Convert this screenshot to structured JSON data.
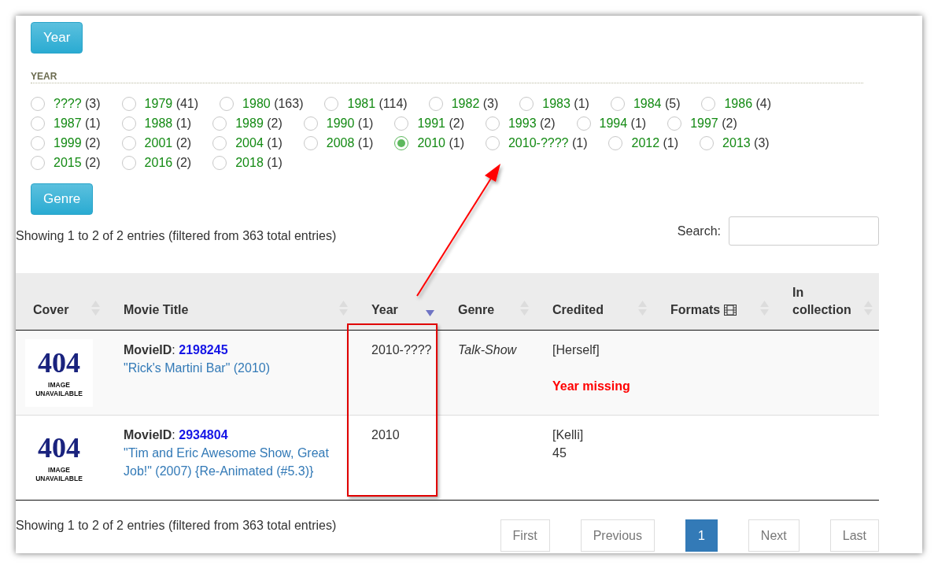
{
  "year_button": "Year",
  "filter_heading": "YEAR",
  "year_options": [
    {
      "label": "????",
      "count": "(3)",
      "selected": false
    },
    {
      "label": "1979",
      "count": "(41)",
      "selected": false
    },
    {
      "label": "1980",
      "count": "(163)",
      "selected": false
    },
    {
      "label": "1981",
      "count": "(114)",
      "selected": false
    },
    {
      "label": "1982",
      "count": "(3)",
      "selected": false
    },
    {
      "label": "1983",
      "count": "(1)",
      "selected": false
    },
    {
      "label": "1984",
      "count": "(5)",
      "selected": false
    },
    {
      "label": "1986",
      "count": "(4)",
      "selected": false
    },
    {
      "label": "1987",
      "count": "(1)",
      "selected": false
    },
    {
      "label": "1988",
      "count": "(1)",
      "selected": false
    },
    {
      "label": "1989",
      "count": "(2)",
      "selected": false
    },
    {
      "label": "1990",
      "count": "(1)",
      "selected": false
    },
    {
      "label": "1991",
      "count": "(2)",
      "selected": false
    },
    {
      "label": "1993",
      "count": "(2)",
      "selected": false
    },
    {
      "label": "1994",
      "count": "(1)",
      "selected": false
    },
    {
      "label": "1997",
      "count": "(2)",
      "selected": false
    },
    {
      "label": "1999",
      "count": "(2)",
      "selected": false
    },
    {
      "label": "2001",
      "count": "(2)",
      "selected": false
    },
    {
      "label": "2004",
      "count": "(1)",
      "selected": false
    },
    {
      "label": "2008",
      "count": "(1)",
      "selected": false
    },
    {
      "label": "2010",
      "count": "(1)",
      "selected": true
    },
    {
      "label": "2010-????",
      "count": "(1)",
      "selected": false
    },
    {
      "label": "2012",
      "count": "(1)",
      "selected": false
    },
    {
      "label": "2013",
      "count": "(3)",
      "selected": false
    },
    {
      "label": "2015",
      "count": "(2)",
      "selected": false
    },
    {
      "label": "2016",
      "count": "(2)",
      "selected": false
    },
    {
      "label": "2018",
      "count": "(1)",
      "selected": false
    }
  ],
  "genre_button": "Genre",
  "info_top": "Showing 1 to 2 of 2 entries (filtered from 363 total entries)",
  "search": {
    "label": "Search:"
  },
  "table": {
    "columns": [
      {
        "label": "Cover",
        "sorted": false,
        "icon": false
      },
      {
        "label": "Movie Title",
        "sorted": false,
        "icon": false
      },
      {
        "label": "Year",
        "sorted": true,
        "icon": false
      },
      {
        "label": "Genre",
        "sorted": false,
        "icon": false
      },
      {
        "label": "Credited",
        "sorted": false,
        "icon": false
      },
      {
        "label": "Formats",
        "sorted": false,
        "icon": true
      },
      {
        "label": "In collection",
        "sorted": false,
        "icon": false
      }
    ],
    "rows": [
      {
        "cover": {
          "code": "404",
          "caption": "IMAGE UNAVAILABLE"
        },
        "id_label": "**MovieID**:",
        "id": "2198245",
        "title": "\"Rick's Martini Bar\" (2010)",
        "year": "2010-????",
        "genre": "Talk-Show",
        "credited": [
          {
            "kind": "text",
            "text": "[Herself]"
          },
          {
            "kind": "warning",
            "text": "Year missing"
          }
        ]
      },
      {
        "cover": {
          "code": "404",
          "caption": "IMAGE UNAVAILABLE"
        },
        "id_label": "**MovieID**:",
        "id": "2934804",
        "title": "\"Tim and Eric Awesome Show, Great Job!\" (2007) {Re-Animated (#5.3)}",
        "year": "2010",
        "credited": [
          {
            "kind": "text",
            "text": "[Kelli]"
          },
          {
            "kind": "text",
            "text": "45"
          }
        ]
      }
    ]
  },
  "info_bottom": "Showing 1 to 2 of 2 entries (filtered from 363 total entries)",
  "pagination": [
    {
      "label": "First",
      "selected": false
    },
    {
      "label": "Previous",
      "selected": false
    },
    {
      "label": "1",
      "selected": true
    },
    {
      "label": "Next",
      "selected": false
    },
    {
      "label": "Last",
      "selected": false
    }
  ]
}
